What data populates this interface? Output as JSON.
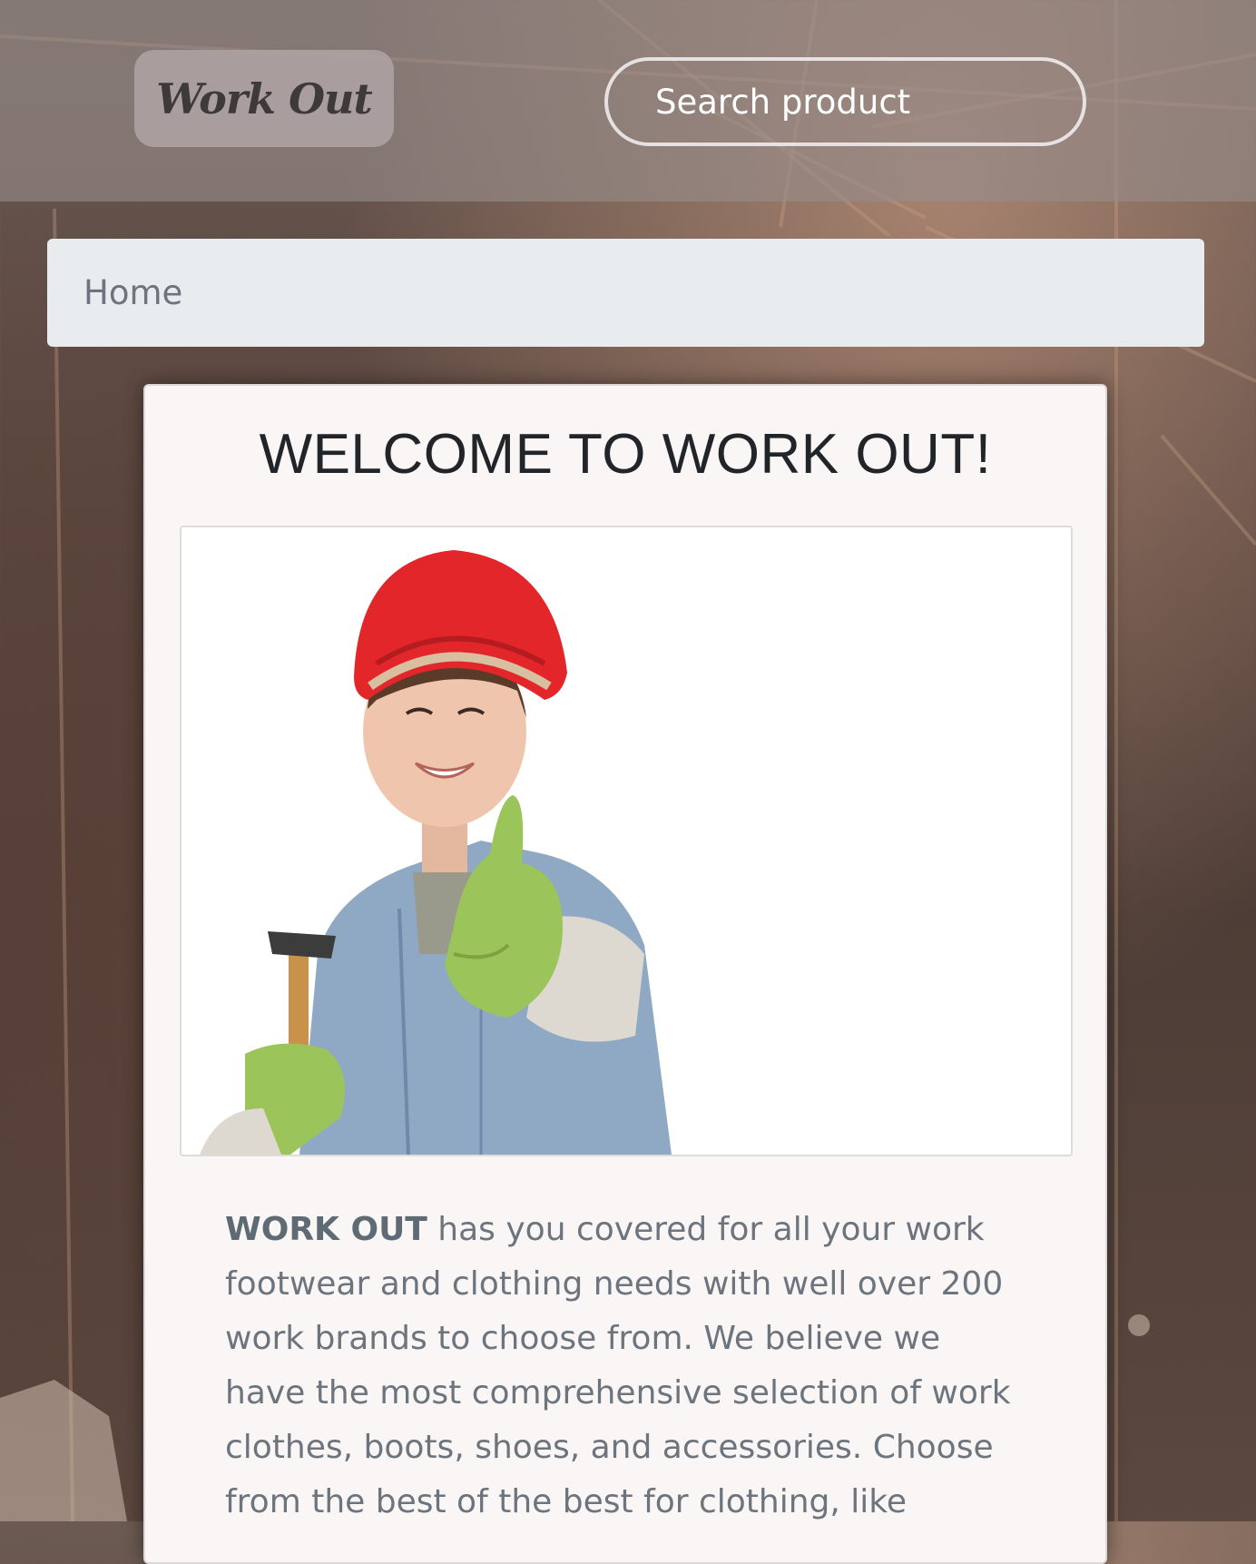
{
  "header": {
    "logo_text": "Work Out",
    "search_placeholder": "Search product"
  },
  "breadcrumb": {
    "items": [
      {
        "label": "Home"
      }
    ]
  },
  "main": {
    "title": "WELCOME TO WORK OUT!",
    "intro_strong": "WORK OUT",
    "intro_text": " has you covered for all your work footwear and clothing needs with well over 200 work brands to choose from. We believe we have the most comprehensive selection of work clothes, boots, shoes, and accessories. Choose from the best of the best for clothing, like"
  },
  "colors": {
    "breadcrumb_bg": "#e9ecef",
    "card_bg": "#fbf6f6",
    "text_muted": "#6c757d",
    "helmet_red": "#e3262a",
    "glove_green": "#9bc45a",
    "denim_blue": "#8fa9c4"
  }
}
